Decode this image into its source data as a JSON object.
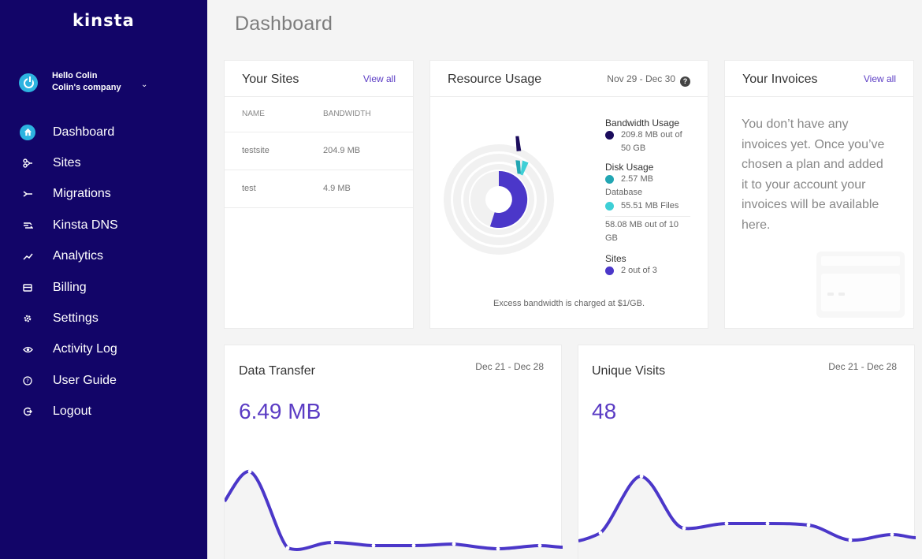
{
  "brand": {
    "logo": "kinsta",
    "accent": "#5b3cc4",
    "sidebar_bg": "#120568",
    "active_icon_bg": "#2db3e0"
  },
  "user": {
    "greeting": "Hello Colin",
    "company": "Colin's company"
  },
  "nav": [
    {
      "label": "Dashboard",
      "icon": "home-icon"
    },
    {
      "label": "Sites",
      "icon": "sites-icon"
    },
    {
      "label": "Migrations",
      "icon": "migrations-icon"
    },
    {
      "label": "Kinsta DNS",
      "icon": "dns-icon"
    },
    {
      "label": "Analytics",
      "icon": "analytics-icon"
    },
    {
      "label": "Billing",
      "icon": "billing-icon"
    },
    {
      "label": "Settings",
      "icon": "settings-icon"
    },
    {
      "label": "Activity Log",
      "icon": "eye-icon"
    },
    {
      "label": "User Guide",
      "icon": "help-icon"
    },
    {
      "label": "Logout",
      "icon": "logout-icon"
    }
  ],
  "page": {
    "title": "Dashboard"
  },
  "sites": {
    "title": "Your Sites",
    "view_all": "View all",
    "columns": [
      "NAME",
      "BANDWIDTH"
    ],
    "rows": [
      {
        "name": "testsite",
        "bandwidth": "204.9 MB"
      },
      {
        "name": "test",
        "bandwidth": "4.9 MB"
      }
    ]
  },
  "resource": {
    "title": "Resource Usage",
    "date_range": "Nov 29 - Dec 30",
    "bandwidth_heading": "Bandwidth Usage",
    "bandwidth_value": "209.8 MB out of 50 GB",
    "disk_heading": "Disk Usage",
    "disk_database": "2.57 MB",
    "disk_database_label": "Database",
    "disk_files": "55.51 MB Files",
    "disk_total": "58.08 MB out of 10 GB",
    "sites_heading": "Sites",
    "sites_value": "2 out of 3",
    "footnote": "Excess bandwidth is charged at $1/GB.",
    "colors": {
      "bandwidth": "#1b0c5c",
      "database": "#22a6b3",
      "files": "#3ecfd6",
      "sites": "#4b37c9",
      "track": "#f1f1f1"
    },
    "usage_fractions": {
      "bandwidth": 0.004,
      "disk": 0.0057,
      "sites": 0.6667
    }
  },
  "invoices": {
    "title": "Your Invoices",
    "view_all": "View all",
    "message": "You don’t have any invoices yet. Once you’ve chosen a plan and added it to your account your invoices will be available here."
  },
  "data_transfer": {
    "title": "Data Transfer",
    "date_range": "Dec 21 - Dec 28",
    "value": "6.49 MB"
  },
  "unique_visits": {
    "title": "Unique Visits",
    "date_range": "Dec 21 - Dec 28",
    "value": "48"
  }
}
